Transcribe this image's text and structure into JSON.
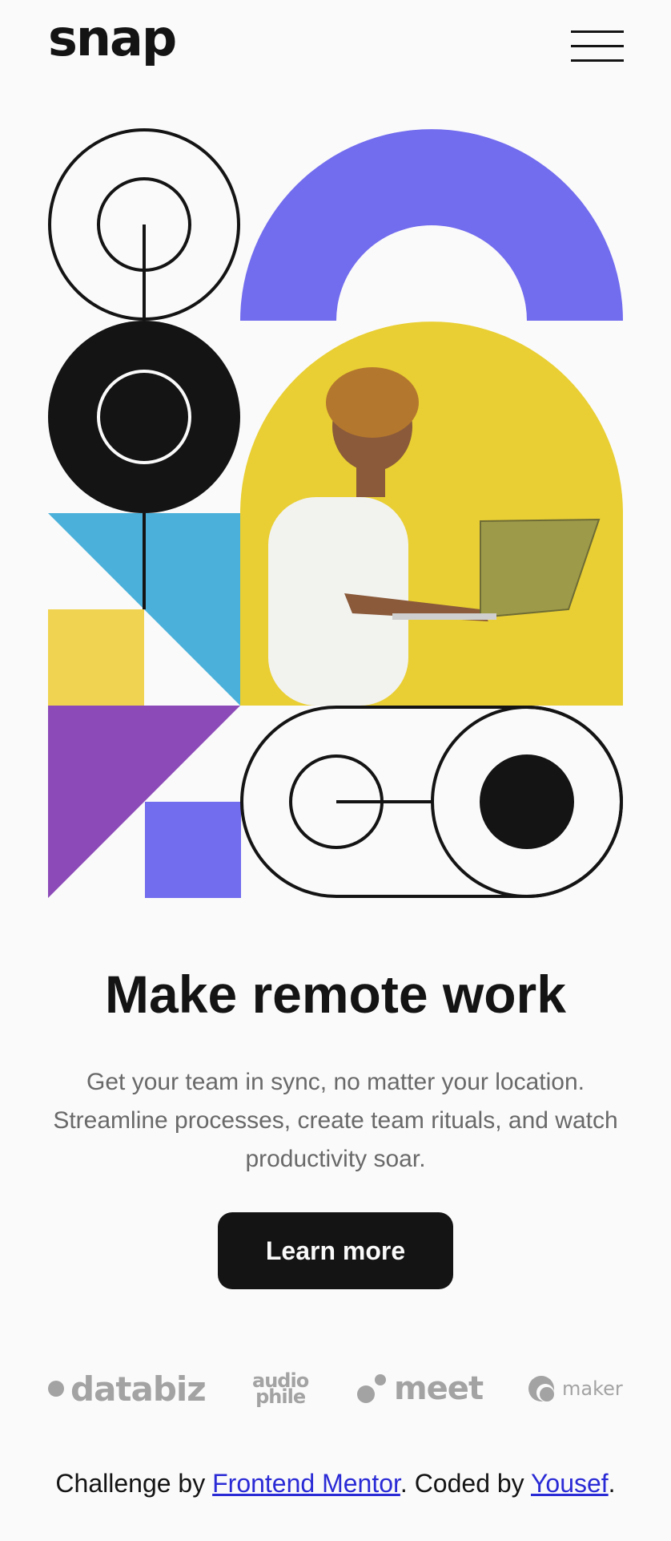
{
  "header": {
    "logo": "snap",
    "menu_icon": "hamburger-icon"
  },
  "hero": {
    "image_alt": "man-with-laptop-illustration",
    "colors": {
      "purple": "#726cee",
      "yellow": "#e9cf33",
      "blue": "#4bb1da",
      "violet": "#8c4ab8",
      "black": "#141414"
    }
  },
  "content": {
    "title": "Make remote work",
    "subtitle": "Get your team in sync, no matter your location. Streamline processes, create team rituals, and watch productivity soar.",
    "cta_label": "Learn more"
  },
  "clients": {
    "databiz": "databiz",
    "audiophile_top": "audio",
    "audiophile_bottom": "phile",
    "meet": "meet",
    "maker": "maker"
  },
  "attribution": {
    "prefix": "Challenge by ",
    "link1": "Frontend Mentor",
    "middle": ". Coded by ",
    "link2": "Yousef",
    "suffix": "."
  }
}
